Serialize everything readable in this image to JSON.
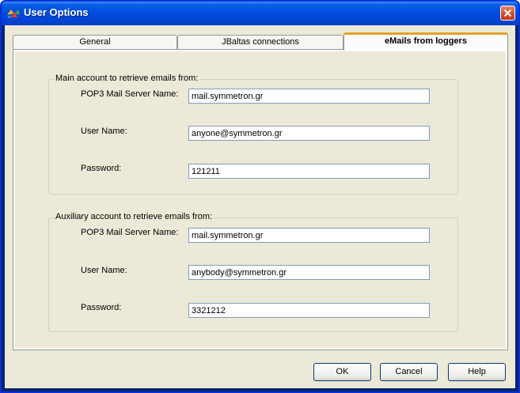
{
  "window": {
    "title": "User Options",
    "icons": {
      "app": "app-icon",
      "close": "close-icon"
    }
  },
  "tabs": [
    {
      "label": "General",
      "selected": false
    },
    {
      "label": "JBaltas  connections",
      "selected": false
    },
    {
      "label": "eMails from loggers",
      "selected": true
    }
  ],
  "main_account": {
    "legend": "Main account to retrieve emails from:",
    "server_label": "POP3 Mail Server Name:",
    "server_value": "mail.symmetron.gr",
    "user_label": "User Name:",
    "user_value": "anyone@symmetron.gr",
    "password_label": "Password:",
    "password_value": "121211"
  },
  "aux_account": {
    "legend": "Auxiliary account to retrieve emails from:",
    "server_label": "POP3 Mail Server Name:",
    "server_value": "mail.symmetron.gr",
    "user_label": "User Name:",
    "user_value": "anybody@symmetron.gr",
    "password_label": "Password:",
    "password_value": "3321212"
  },
  "buttons": {
    "ok": "OK",
    "cancel": "Cancel",
    "help": "Help"
  },
  "colors": {
    "titlebar": "#0054e3",
    "active_tab_accent": "#e3a02a",
    "close_button": "#d04b25"
  }
}
